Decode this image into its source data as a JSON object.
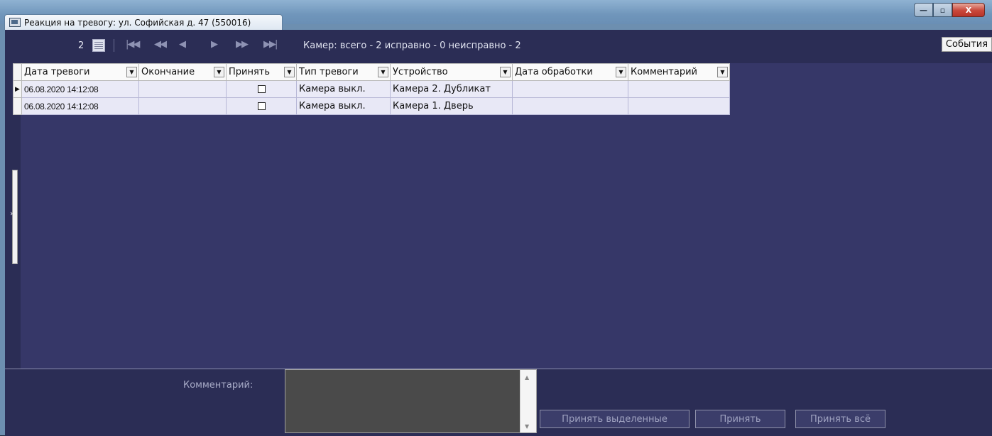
{
  "window": {
    "title": "Реакция на тревогу: ул. Софийская д. 47 (550016)",
    "controls": {
      "minimize": "—",
      "maximize": "▫",
      "close": "X"
    }
  },
  "toolbar": {
    "page_count": "2",
    "status": "Камер: всего - 2 исправно - 0  неисправно - 2",
    "events_button": "События",
    "nav": [
      "first",
      "prev-page",
      "prev",
      "next",
      "next-page",
      "last"
    ]
  },
  "grid": {
    "columns": [
      "Дата тревоги",
      "Окончание",
      "Принять",
      "Тип тревоги",
      "Устройство",
      "Дата обработки",
      "Комментарий"
    ],
    "rows": [
      {
        "date": "06.08.2020 14:12:08",
        "end": "",
        "accept": false,
        "type": "Камера выкл.",
        "device": "Камера 2. Дубликат",
        "processed": "",
        "comment": "",
        "selected": true
      },
      {
        "date": "06.08.2020 14:12:08",
        "end": "",
        "accept": false,
        "type": "Камера выкл.",
        "device": "Камера 1. Дверь",
        "processed": "",
        "comment": "",
        "selected": false
      }
    ]
  },
  "bottom": {
    "comment_label": "Комментарий:",
    "comment_value": "",
    "buttons": {
      "accept_selected": "Принять выделенные",
      "accept": "Принять",
      "accept_all": "Принять всё"
    }
  },
  "colors": {
    "client_bg": "#2b2d55",
    "grid_bg": "#363768",
    "row_bg": "#e8e8f6"
  }
}
